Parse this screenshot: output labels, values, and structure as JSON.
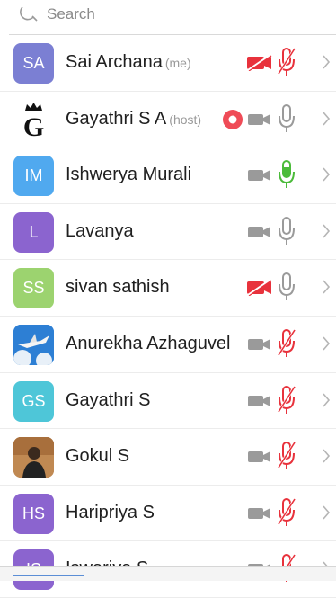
{
  "search": {
    "placeholder": "Search"
  },
  "participants": [
    {
      "initials": "SA",
      "name": "Sai Archana",
      "tag": "(me)",
      "avatar_color": "#7b7fd3",
      "avatar_type": "initials",
      "video": "off",
      "audio": "muted",
      "recording": false
    },
    {
      "initials": "",
      "name": "Gayathri S A",
      "tag": "(host)",
      "avatar_color": "#ffffff",
      "avatar_type": "crown-g-logo",
      "video": "on",
      "audio": "on",
      "recording": true
    },
    {
      "initials": "IM",
      "name": "Ishwerya Murali",
      "tag": "",
      "avatar_color": "#50a9ef",
      "avatar_type": "initials",
      "video": "on",
      "audio": "speaking",
      "recording": false
    },
    {
      "initials": "L",
      "name": "Lavanya",
      "tag": "",
      "avatar_color": "#8b64cf",
      "avatar_type": "initials",
      "video": "on",
      "audio": "on",
      "recording": false
    },
    {
      "initials": "SS",
      "name": "sivan sathish",
      "tag": "",
      "avatar_color": "#9cd36f",
      "avatar_type": "initials",
      "video": "off",
      "audio": "on",
      "recording": false
    },
    {
      "initials": "",
      "name": "Anurekha Azhaguvel",
      "tag": "",
      "avatar_color": "#3c89d6",
      "avatar_type": "photo-sky",
      "video": "on",
      "audio": "muted",
      "recording": false
    },
    {
      "initials": "GS",
      "name": "Gayathri S",
      "tag": "",
      "avatar_color": "#4ec6d8",
      "avatar_type": "initials",
      "video": "on",
      "audio": "muted",
      "recording": false
    },
    {
      "initials": "",
      "name": "Gokul S",
      "tag": "",
      "avatar_color": "#b07a46",
      "avatar_type": "photo-person",
      "video": "on",
      "audio": "muted",
      "recording": false
    },
    {
      "initials": "HS",
      "name": "Haripriya S",
      "tag": "",
      "avatar_color": "#8b64cf",
      "avatar_type": "initials",
      "video": "on",
      "audio": "muted",
      "recording": false
    },
    {
      "initials": "IS",
      "name": "Iswariya S",
      "tag": "",
      "avatar_color": "#8b64cf",
      "avatar_type": "initials",
      "video": "on",
      "audio": "muted",
      "recording": false
    }
  ],
  "colors": {
    "muted_red": "#e8323c",
    "speaking_green": "#4bbb3a",
    "icon_gray": "#9a9a9a",
    "record_red": "#ef4b57"
  }
}
